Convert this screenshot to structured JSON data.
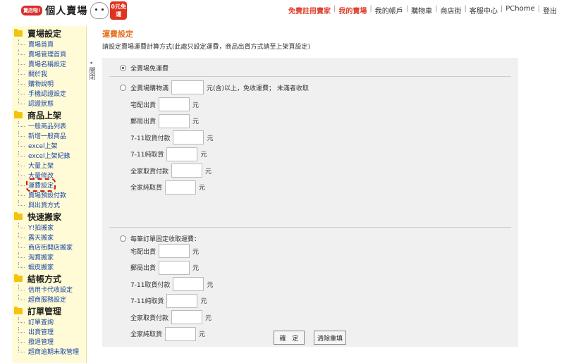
{
  "header": {
    "badge": "賣店啦!",
    "brand": "個人賣場",
    "promo": "0元免運",
    "nav": [
      {
        "label": "免費註冊賣家",
        "highlight": true
      },
      {
        "label": "我的賣場",
        "highlight": true
      },
      {
        "label": "我的帳戶",
        "highlight": false
      },
      {
        "label": "購物車",
        "highlight": false
      },
      {
        "label": "商店街",
        "highlight": false
      },
      {
        "label": "客服中心",
        "highlight": false
      },
      {
        "label": "PChome",
        "highlight": false
      },
      {
        "label": "登出",
        "highlight": false
      }
    ]
  },
  "sidebar": [
    {
      "title": "賣場設定",
      "items": [
        "賣場首頁",
        "賣場管理首頁",
        "賣場名稱設定",
        "關於我",
        "購物說明",
        "手機認證設定",
        "認證狀態"
      ]
    },
    {
      "title": "商品上架",
      "items": [
        "一般商品列表",
        "新增一般商品",
        "excel上架",
        "excel上架紀錄",
        "大量上架",
        "大量修改",
        "運費設定",
        "賣場預設付款",
        "與出貨方式"
      ]
    },
    {
      "title": "快速搬家",
      "items": [
        "Y!拍搬家",
        "露天搬家",
        "商店街開店搬家",
        "淘寶搬家",
        "蝦皮搬家"
      ]
    },
    {
      "title": "結帳方式",
      "items": [
        "信用卡代收設定",
        "超商服務設定"
      ]
    },
    {
      "title": "訂單管理",
      "items": [
        "訂單查詢",
        "出貨管理",
        "撥退管理",
        "超商逾期未取管理"
      ]
    }
  ],
  "collapse_label": "關閉",
  "main": {
    "title": "運費設定",
    "desc": "請設定賣場運費計算方式(此處只設定運費，商品出貨方式請至上架頁設定)",
    "opt1": "全賣場免運費",
    "opt2_prefix": "全賣場購物滿",
    "opt2_suffix": "元(含)以上，免收運費； 未滿者收取",
    "opt3": "每筆訂單固定收取運費：",
    "unit": "元",
    "fees": [
      "宅配出貨",
      "郵局出貨",
      "7-11取貨付款",
      "7-11純取貨",
      "全家取貨付款",
      "全家純取貨"
    ],
    "confirm": "確　定",
    "reset": "清除重填"
  }
}
